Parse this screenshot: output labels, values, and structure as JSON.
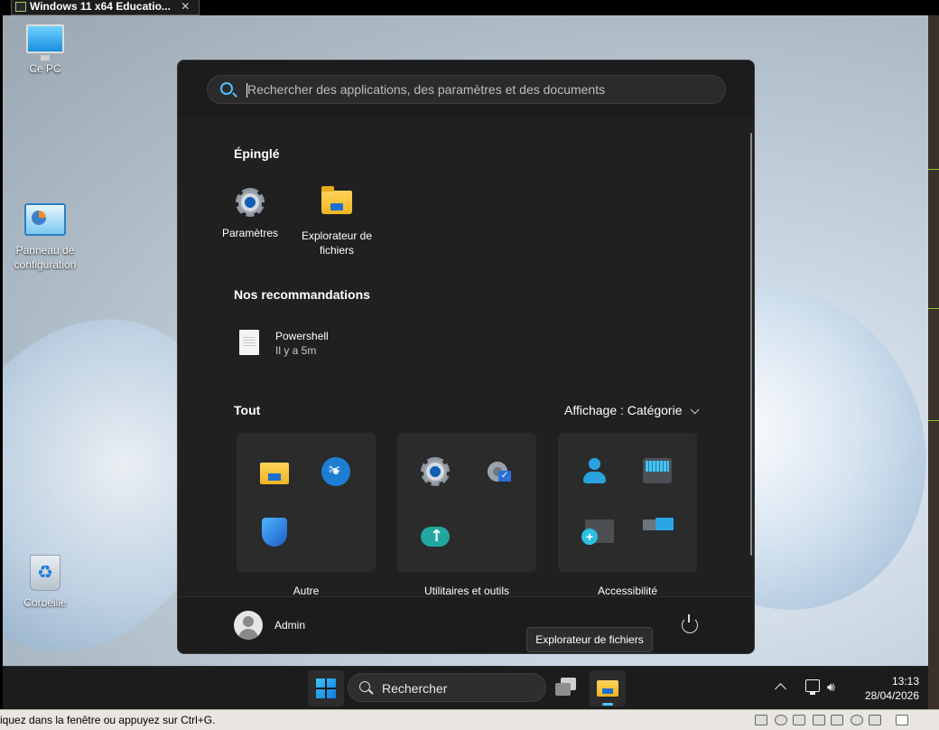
{
  "vm": {
    "tab_title": "Windows 11 x64 Educatio...",
    "tab_close": "✕",
    "status_text": "iquez dans la fenêtre ou appuyez sur Ctrl+G."
  },
  "desktop": {
    "icons": [
      {
        "label": "Ce PC",
        "icon": "this-pc-icon"
      },
      {
        "label": "Panneau de configuration",
        "icon": "control-panel-icon"
      },
      {
        "label": "Corbeille",
        "icon": "recycle-bin-icon"
      }
    ]
  },
  "start_menu": {
    "search_placeholder": "Rechercher des applications, des paramètres et des documents",
    "pinned_title": "Épinglé",
    "pinned": [
      {
        "label": "Paramètres",
        "icon": "settings-icon"
      },
      {
        "label": "Explorateur de fichiers",
        "icon": "file-explorer-icon"
      }
    ],
    "recommended_title": "Nos recommandations",
    "recommended": [
      {
        "name": "Powershell",
        "time": "Il y a 5m",
        "icon": "document-icon"
      }
    ],
    "all_title": "Tout",
    "view_label": "Affichage : Catégorie",
    "categories": [
      {
        "label": "Autre",
        "icons": [
          "file-explorer-icon",
          "snipping-tool-icon",
          "defender-icon"
        ]
      },
      {
        "label": "Utilitaires et outils",
        "icons": [
          "settings-icon",
          "system-config-icon",
          "backup-icon"
        ]
      },
      {
        "label": "Accessibilité",
        "icons": [
          "voice-access-icon",
          "on-screen-keyboard-icon",
          "magnifier-icon",
          "narrator-icon"
        ]
      }
    ],
    "user_name": "Admin"
  },
  "tooltip": "Explorateur de fichiers",
  "taskbar": {
    "search_label": "Rechercher",
    "time": "13:13",
    "date": "28/04/2026"
  },
  "colors": {
    "accent": "#4cc2ff",
    "start_bg": "#202020",
    "taskbar_bg": "#1c1c1c"
  }
}
